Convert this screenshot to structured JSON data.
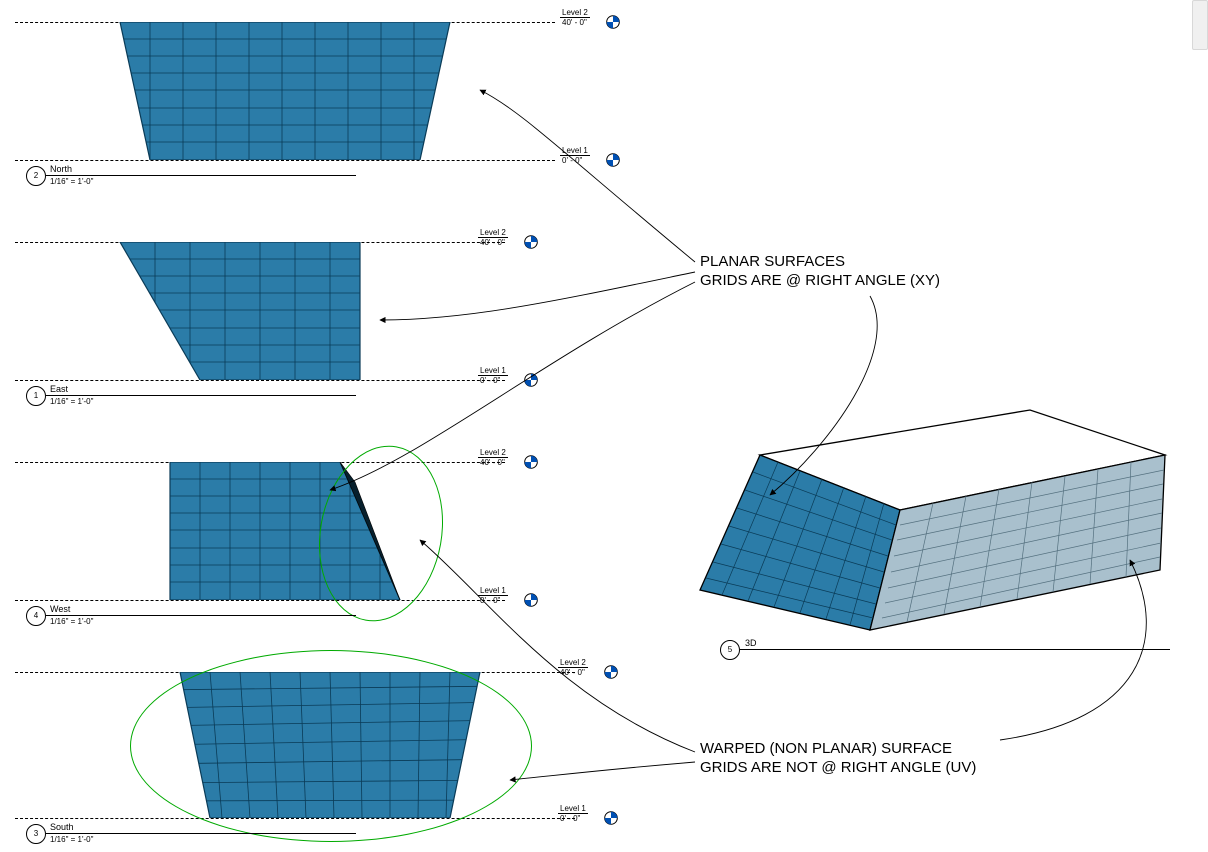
{
  "levels": {
    "top": {
      "name": "Level 2",
      "elev": "40' - 0\""
    },
    "bottom": {
      "name": "Level 1",
      "elev": "0' - 0\""
    }
  },
  "views": {
    "north": {
      "num": "2",
      "name": "North",
      "scale": "1/16\" = 1'-0\""
    },
    "east": {
      "num": "1",
      "name": "East",
      "scale": "1/16\" = 1'-0\""
    },
    "west": {
      "num": "4",
      "name": "West",
      "scale": "1/16\" = 1'-0\""
    },
    "south": {
      "num": "3",
      "name": "South",
      "scale": "1/16\" = 1'-0\""
    },
    "threeD": {
      "num": "5",
      "name": "3D"
    }
  },
  "annotations": {
    "planar1": "PLANAR SURFACES",
    "planar2": "GRIDS ARE @ RIGHT ANGLE (XY)",
    "warped1": "WARPED (NON PLANAR) SURFACE",
    "warped2": "GRIDS ARE NOT @ RIGHT ANGLE (UV)"
  },
  "colors": {
    "panel_fill": "#2b7ca8",
    "panel_stroke": "#0a3b57",
    "iso_front": "#2b7ca8",
    "iso_side": "#9fb7c4",
    "iso_top": "#ffffff",
    "highlight": "#00aa00"
  }
}
